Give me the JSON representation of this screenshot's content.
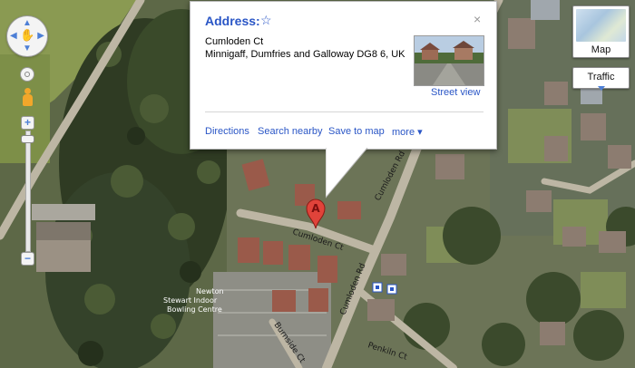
{
  "info_window": {
    "title": "Address:",
    "address_line1": "Cumloden Ct",
    "address_line2": "Minnigaff, Dumfries and Galloway DG8 6, UK",
    "street_view_link": "Street view",
    "actions": [
      "Directions",
      "Search nearby",
      "Save to map",
      "more ▾"
    ],
    "close_symbol": "×",
    "star_symbol": "☆"
  },
  "marker": {
    "letter": "A",
    "color": "#e0433a"
  },
  "map_controls": {
    "map_type_label": "Map",
    "traffic_label": "Traffic",
    "zoom_in_symbol": "+",
    "zoom_out_symbol": "−"
  },
  "map_labels": {
    "roads": [
      "Cumloden Ct",
      "Cumloden Rd",
      "Cumloden Rd",
      "Burnside Ct",
      "Penkiln Ct"
    ],
    "place_line1": "Newton",
    "place_line2": "Stewart Indoor",
    "place_line3": "Bowling Centre"
  },
  "colors": {
    "link_blue": "#2a56c6",
    "road": "#b9b2a0",
    "vegetation_dark": "#3c4a2c",
    "vegetation_light": "#7e8a55"
  }
}
